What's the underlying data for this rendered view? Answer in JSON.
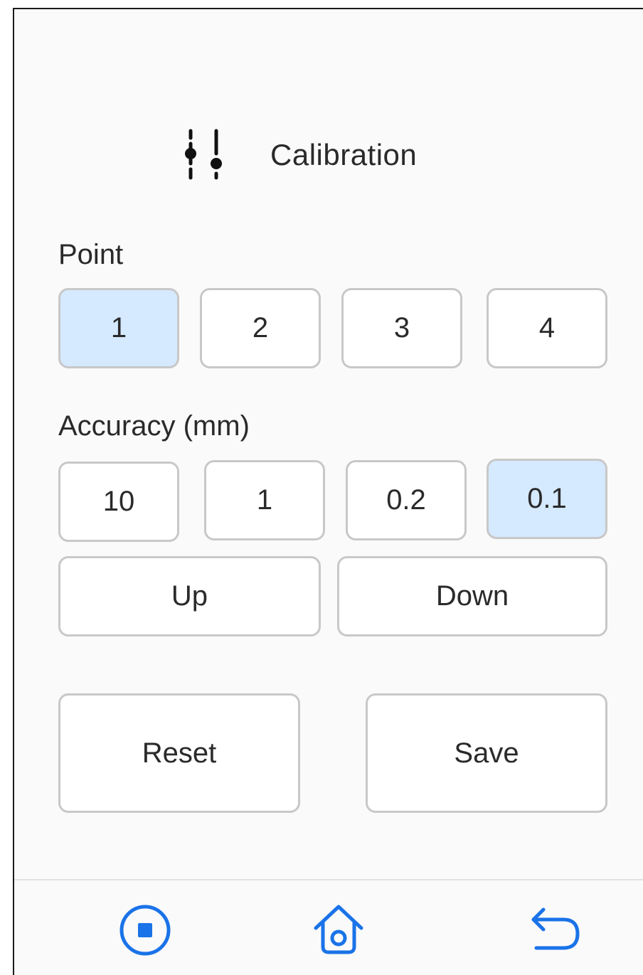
{
  "header": {
    "title": "Calibration",
    "icon": "sliders-icon"
  },
  "point": {
    "label": "Point",
    "options": [
      "1",
      "2",
      "3",
      "4"
    ],
    "selected": "1"
  },
  "accuracy": {
    "label": "Accuracy (mm)",
    "options": [
      "10",
      "1",
      "0.2",
      "0.1"
    ],
    "selected": "0.1"
  },
  "move": {
    "up_label": "Up",
    "down_label": "Down"
  },
  "actions": {
    "reset_label": "Reset",
    "save_label": "Save"
  },
  "bottom_nav": {
    "icons": [
      "stop-icon",
      "home-icon",
      "back-icon"
    ],
    "accent_color": "#1a73e8"
  },
  "colors": {
    "selected_bg": "#d5e9ff",
    "border": "#c8c8c8",
    "text": "#2a2a2a"
  }
}
